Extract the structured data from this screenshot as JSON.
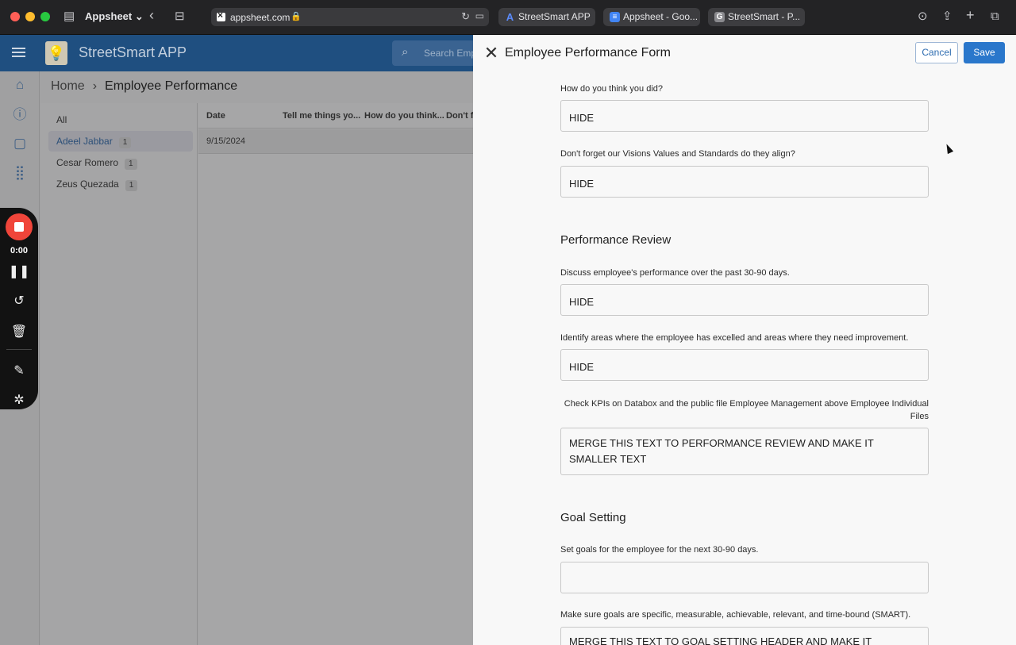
{
  "browser": {
    "profile": "Appsheet",
    "url": "appsheet.com",
    "tabs": [
      {
        "label": "StreetSmart APP"
      },
      {
        "label": "Appsheet - Goo..."
      },
      {
        "label": "StreetSmart - P..."
      }
    ]
  },
  "app": {
    "title": "StreetSmart APP",
    "search_placeholder": "Search Emp",
    "breadcrumb": {
      "home": "Home",
      "current": "Employee Performance"
    },
    "groups": [
      {
        "label": "All",
        "count": ""
      },
      {
        "label": "Adeel Jabbar",
        "count": "1"
      },
      {
        "label": "Cesar Romero",
        "count": "1"
      },
      {
        "label": "Zeus Quezada",
        "count": "1"
      }
    ],
    "columns": [
      "Date",
      "Tell me things yo...",
      "How do you think...",
      "Don't fo"
    ],
    "rows": [
      {
        "date": "9/15/2024"
      }
    ]
  },
  "recorder": {
    "time": "0:00"
  },
  "form": {
    "title": "Employee Performance Form",
    "cancel_label": "Cancel",
    "save_label": "Save",
    "q1_label": "How do you think you did?",
    "q1_value": "HIDE",
    "q2_label": "Don't forget our Visions Values and Standards do they align?",
    "q2_value": "HIDE",
    "performance_header": "Performance Review",
    "q3_label": "Discuss employee's performance over the past 30-90 days.",
    "q3_value": "HIDE",
    "q4_label": "Identify areas where the employee has excelled and areas where they need improvement.",
    "q4_value": "HIDE",
    "kpi_note": "Check KPIs on Databox and the public file Employee Management above Employee Individual Files",
    "q5_value": "MERGE THIS TEXT TO PERFORMANCE REVIEW AND MAKE IT SMALLER TEXT",
    "goal_header": "Goal Setting",
    "q6_label": "Set goals for the employee for the next 30-90 days.",
    "q6_value": "",
    "q7_label": "Make sure goals are specific, measurable, achievable, relevant, and time-bound (SMART).",
    "q7_value": "MERGE THIS TEXT TO GOAL SETTING HEADER AND MAKE IT SMALLER"
  }
}
